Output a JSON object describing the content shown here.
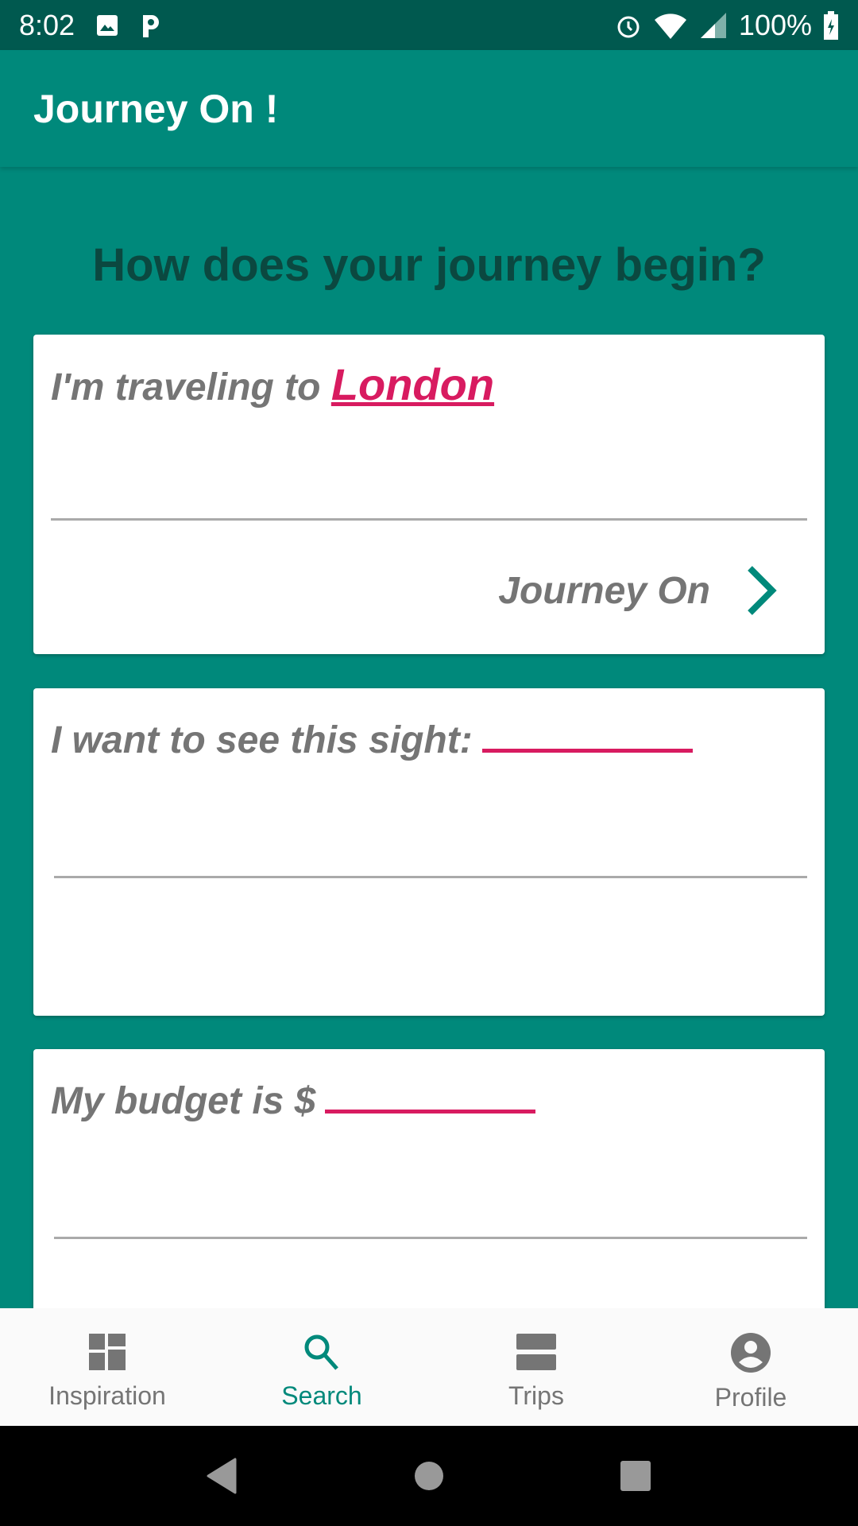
{
  "status_bar": {
    "time": "8:02",
    "battery": "100%"
  },
  "app_bar": {
    "title": "Journey On !"
  },
  "heading": "How does your journey begin?",
  "cards": [
    {
      "prompt": "I'm traveling to",
      "value": "London",
      "action": "Journey On"
    },
    {
      "prompt": "I want to see this sight:"
    },
    {
      "prompt": "My budget is $"
    }
  ],
  "bottom_nav": [
    {
      "label": "Inspiration",
      "icon": "dashboard-icon"
    },
    {
      "label": "Search",
      "icon": "search-icon",
      "active": true
    },
    {
      "label": "Trips",
      "icon": "trips-icon"
    },
    {
      "label": "Profile",
      "icon": "account-circle-icon"
    }
  ],
  "colors": {
    "primary": "#00897b",
    "primary_dark": "#00594f",
    "accent": "#d81b60"
  }
}
